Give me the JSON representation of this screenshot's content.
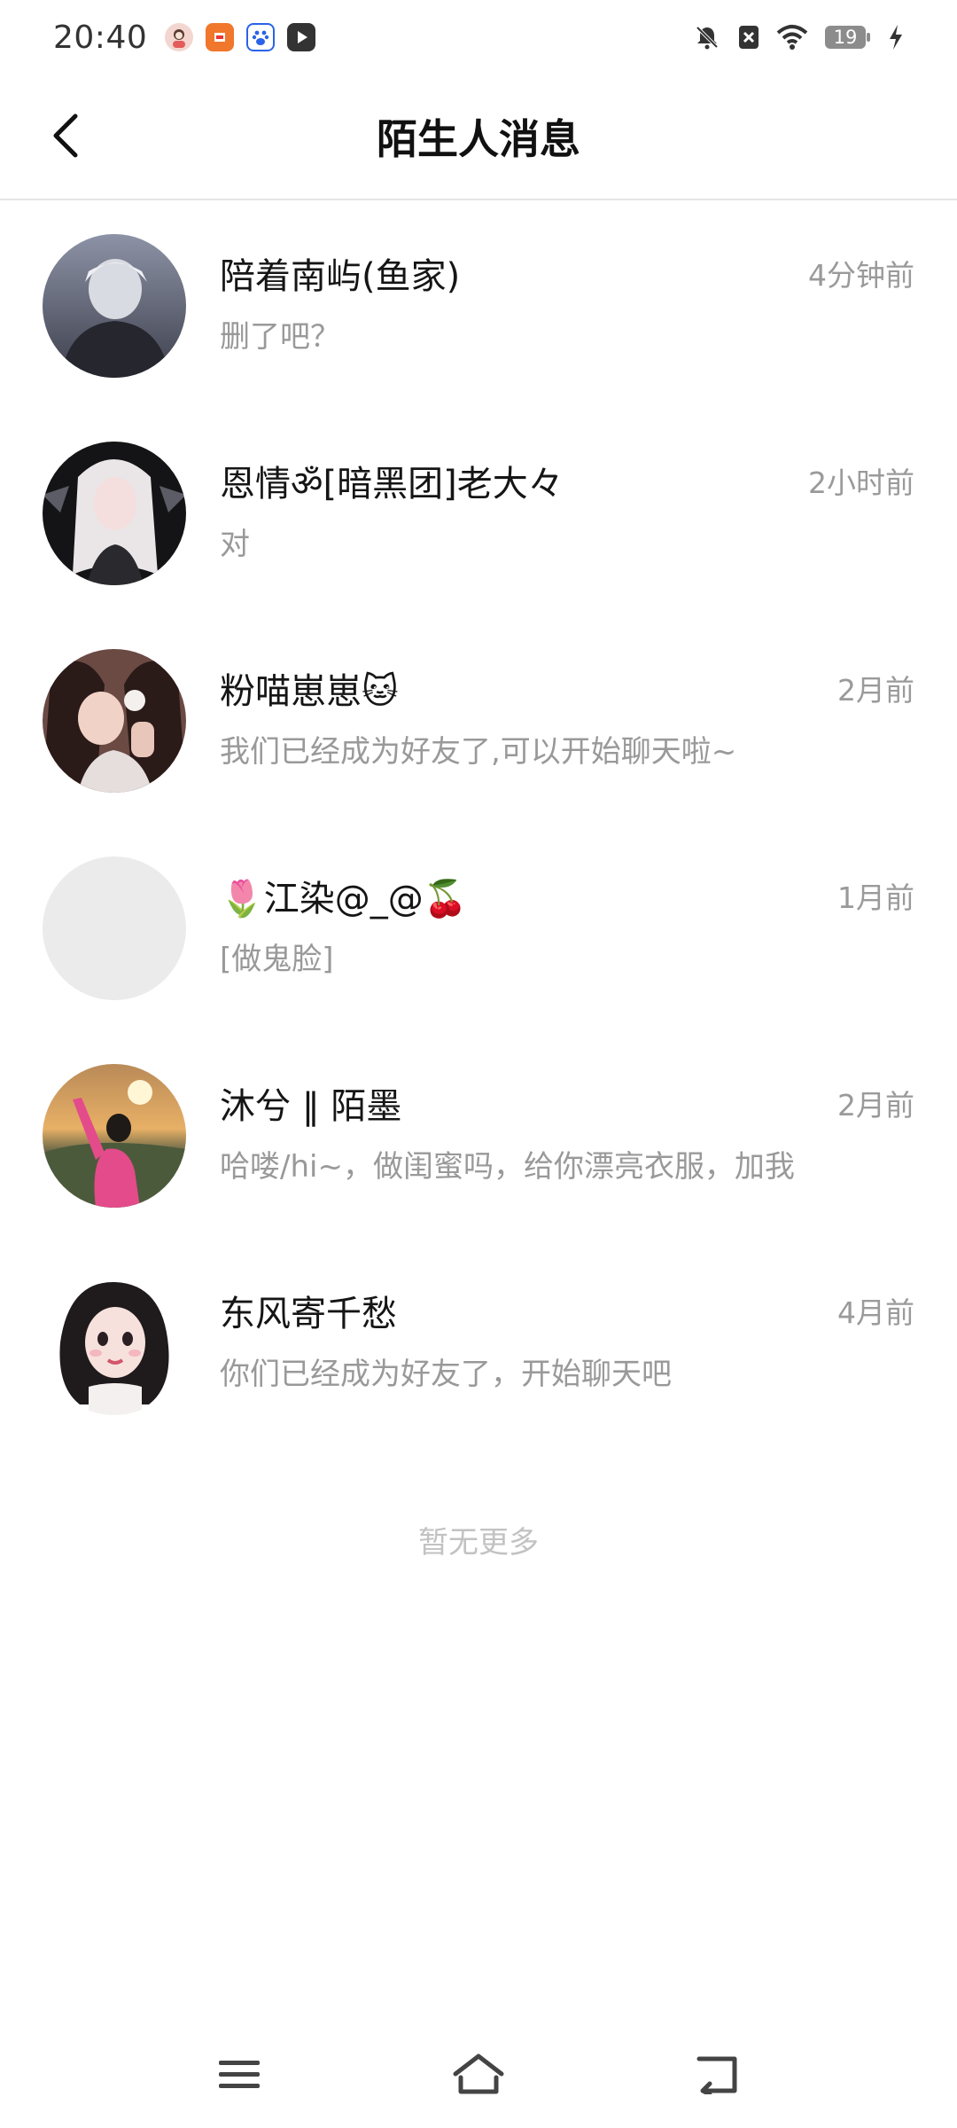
{
  "status_bar": {
    "time": "20:40",
    "battery_level": "19",
    "app_icons": [
      "avatar-app-icon",
      "shopping-app-icon",
      "baidu-app-icon",
      "video-app-icon"
    ]
  },
  "header": {
    "title": "陌生人消息",
    "back_icon": "back-arrow-icon"
  },
  "conversations": [
    {
      "name": "陪着南屿(鱼家)",
      "time": "4分钟前",
      "message": "删了吧？",
      "avatar": "dark-anime-boy-avatar"
    },
    {
      "name": "恩情ॐ[暗黑团]老大々",
      "time": "2小时前",
      "message": "对",
      "avatar": "white-hair-girl-avatar"
    },
    {
      "name": "粉喵崽崽🐱",
      "time": "2月前",
      "message": "我们已经成为好友了,可以开始聊天啦~",
      "avatar": "girl-selfie-avatar"
    },
    {
      "name": "🌷江染@_@🍒",
      "time": "1月前",
      "message": "[做鬼脸]",
      "avatar": "blank-avatar"
    },
    {
      "name": "沐兮 ‖ 陌墨",
      "time": "2月前",
      "message": "哈喽/hi~，做闺蜜吗，给你漂亮衣服，加我",
      "avatar": "sunset-girl-avatar"
    },
    {
      "name": "东风寄千愁",
      "time": "4月前",
      "message": "你们已经成为好友了，开始聊天吧",
      "avatar": "cartoon-girl-avatar"
    }
  ],
  "footer": {
    "no_more": "暂无更多"
  },
  "nav_bar": {
    "icons": [
      "menu-icon",
      "home-icon",
      "back-icon"
    ]
  },
  "colors": {
    "title": "#111111",
    "name": "#151515",
    "secondary": "#999999",
    "divider": "#e5e5e5"
  }
}
